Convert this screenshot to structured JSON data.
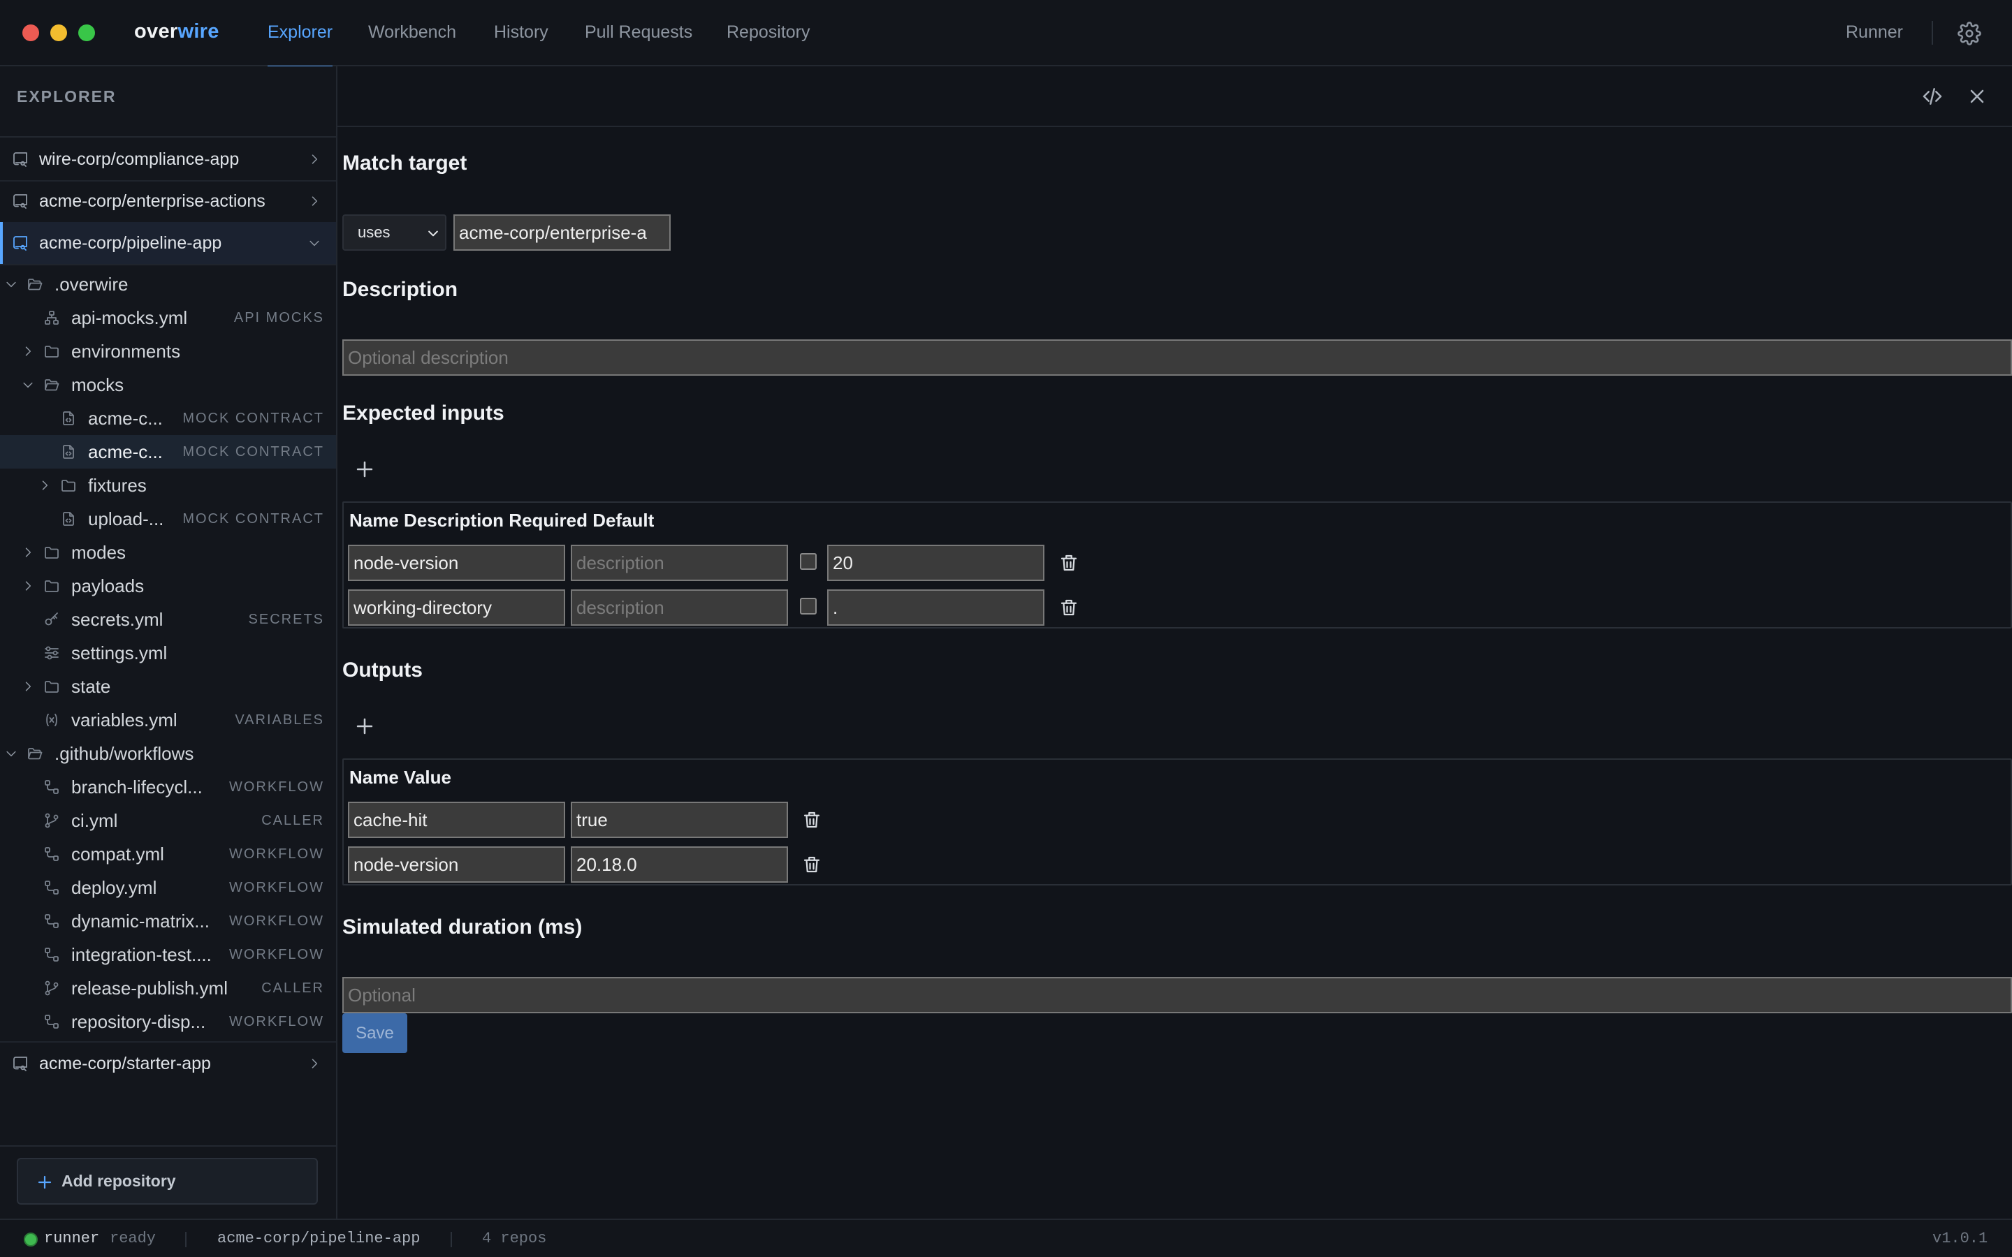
{
  "app": {
    "brand_part1": "over",
    "brand_part2": "wire",
    "colors": {
      "accent": "#58a6ff",
      "background": "#11141a",
      "status_ok": "#3fb950"
    }
  },
  "nav": {
    "tabs": [
      {
        "label": "Explorer",
        "active": true
      },
      {
        "label": "Workbench",
        "active": false
      },
      {
        "label": "History",
        "active": false
      },
      {
        "label": "Pull Requests",
        "active": false
      },
      {
        "label": "Repository",
        "active": false
      }
    ],
    "runner_label": "Runner",
    "settings_icon": "gear-icon"
  },
  "sidebar": {
    "title": "EXPLORER",
    "repos_top": [
      {
        "label": "wire-corp/compliance-app",
        "expanded": false
      },
      {
        "label": "acme-corp/enterprise-actions",
        "expanded": false
      },
      {
        "label": "acme-corp/pipeline-app",
        "expanded": true
      }
    ],
    "tree": [
      {
        "label": ".overwire",
        "tag": "",
        "icon": "folder-open-icon",
        "chevron": "down"
      },
      {
        "label": "api-mocks.yml",
        "tag": "API MOCKS",
        "icon": "sitemap-icon",
        "chevron": ""
      },
      {
        "label": "environments",
        "tag": "",
        "icon": "folder-icon",
        "chevron": "right"
      },
      {
        "label": "mocks",
        "tag": "",
        "icon": "folder-open-icon",
        "chevron": "down"
      },
      {
        "label": "acme-c...",
        "tag": "MOCK CONTRACT",
        "icon": "file-code-icon",
        "chevron": ""
      },
      {
        "label": "acme-c...",
        "tag": "MOCK CONTRACT",
        "icon": "file-code-icon",
        "chevron": "",
        "selected": true
      },
      {
        "label": "fixtures",
        "tag": "",
        "icon": "folder-icon",
        "chevron": "right"
      },
      {
        "label": "upload-...",
        "tag": "MOCK CONTRACT",
        "icon": "file-code-icon",
        "chevron": ""
      },
      {
        "label": "modes",
        "tag": "",
        "icon": "folder-icon",
        "chevron": "right"
      },
      {
        "label": "payloads",
        "tag": "",
        "icon": "folder-icon",
        "chevron": "right"
      },
      {
        "label": "secrets.yml",
        "tag": "SECRETS",
        "icon": "key-icon",
        "chevron": ""
      },
      {
        "label": "settings.yml",
        "tag": "",
        "icon": "sliders-icon",
        "chevron": ""
      },
      {
        "label": "state",
        "tag": "",
        "icon": "folder-icon",
        "chevron": "right"
      },
      {
        "label": "variables.yml",
        "tag": "VARIABLES",
        "icon": "variable-icon",
        "chevron": ""
      },
      {
        "label": ".github/workflows",
        "tag": "",
        "icon": "folder-open-icon",
        "chevron": "down"
      },
      {
        "label": "branch-lifecycl...",
        "tag": "WORKFLOW",
        "icon": "workflow-icon",
        "chevron": ""
      },
      {
        "label": "ci.yml",
        "tag": "CALLER",
        "icon": "git-branch-icon",
        "chevron": ""
      },
      {
        "label": "compat.yml",
        "tag": "WORKFLOW",
        "icon": "workflow-icon",
        "chevron": ""
      },
      {
        "label": "deploy.yml",
        "tag": "WORKFLOW",
        "icon": "workflow-icon",
        "chevron": ""
      },
      {
        "label": "dynamic-matrix...",
        "tag": "WORKFLOW",
        "icon": "workflow-icon",
        "chevron": ""
      },
      {
        "label": "integration-test....",
        "tag": "WORKFLOW",
        "icon": "workflow-icon",
        "chevron": ""
      },
      {
        "label": "release-publish.yml",
        "tag": "CALLER",
        "icon": "git-branch-icon",
        "chevron": ""
      },
      {
        "label": "repository-disp...",
        "tag": "WORKFLOW",
        "icon": "workflow-icon",
        "chevron": ""
      }
    ],
    "repos_bottom": [
      {
        "label": "acme-corp/starter-app",
        "expanded": false
      }
    ],
    "add_repo_label": "Add repository"
  },
  "editor": {
    "match_target": {
      "title": "Match target",
      "mode": "uses",
      "value": "acme-corp/enterprise-a"
    },
    "description": {
      "title": "Description",
      "value": "",
      "placeholder": "Optional description"
    },
    "inputs": {
      "title": "Expected inputs",
      "header": "Name Description Required Default",
      "rows": [
        {
          "name": "node-version",
          "description": "",
          "description_placeholder": "description",
          "required": false,
          "default": "20"
        },
        {
          "name": "working-directory",
          "description": "",
          "description_placeholder": "description",
          "required": false,
          "default": "."
        }
      ]
    },
    "outputs": {
      "title": "Outputs",
      "header": "Name Value",
      "rows": [
        {
          "name": "cache-hit",
          "value": "true"
        },
        {
          "name": "node-version",
          "value": "20.18.0"
        }
      ]
    },
    "duration": {
      "title": "Simulated duration (ms)",
      "value": "",
      "placeholder": "Optional"
    },
    "save_label": "Save"
  },
  "status": {
    "runner_word": "runner",
    "runner_state": "ready",
    "repo": "acme-corp/pipeline-app",
    "repo_count": "4 repos",
    "version": "v1.0.1"
  }
}
